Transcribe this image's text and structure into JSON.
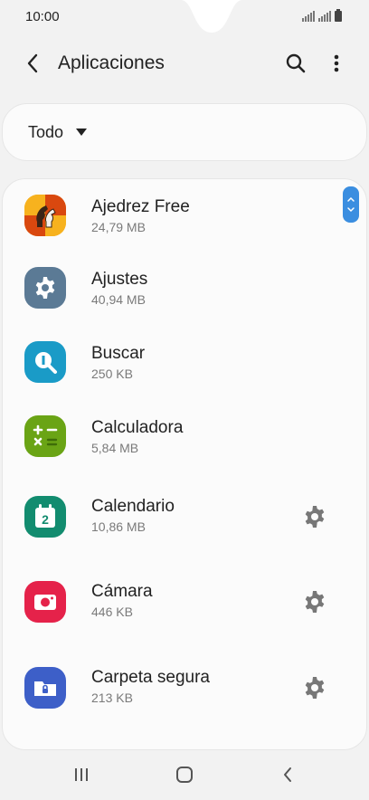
{
  "status_bar": {
    "time": "10:00"
  },
  "app_bar": {
    "title": "Aplicaciones"
  },
  "filter": {
    "label": "Todo"
  },
  "apps": [
    {
      "name": "Ajedrez Free",
      "size": "24,79 MB",
      "icon": "chess-icon",
      "color": "#f2a51b"
    },
    {
      "name": "Ajustes",
      "size": "40,94 MB",
      "icon": "settings-gear-icon",
      "color": "#5b7a95"
    },
    {
      "name": "Buscar",
      "size": "250 KB",
      "icon": "finder-search-icon",
      "color": "#1a9bc7"
    },
    {
      "name": "Calculadora",
      "size": "5,84 MB",
      "icon": "calculator-icon",
      "color": "#6aa415"
    },
    {
      "name": "Calendario",
      "size": "10,86 MB",
      "icon": "calendar-icon",
      "color": "#128c6f"
    },
    {
      "name": "Cámara",
      "size": "446 KB",
      "icon": "camera-icon",
      "color": "#e5224a"
    },
    {
      "name": "Carpeta segura",
      "size": "213 KB",
      "icon": "secure-folder-icon",
      "color": "#3d5fc8"
    }
  ],
  "colors": {
    "accent": "#3b8ee0",
    "background": "#f2f2f2",
    "card": "#fbfbfb"
  }
}
